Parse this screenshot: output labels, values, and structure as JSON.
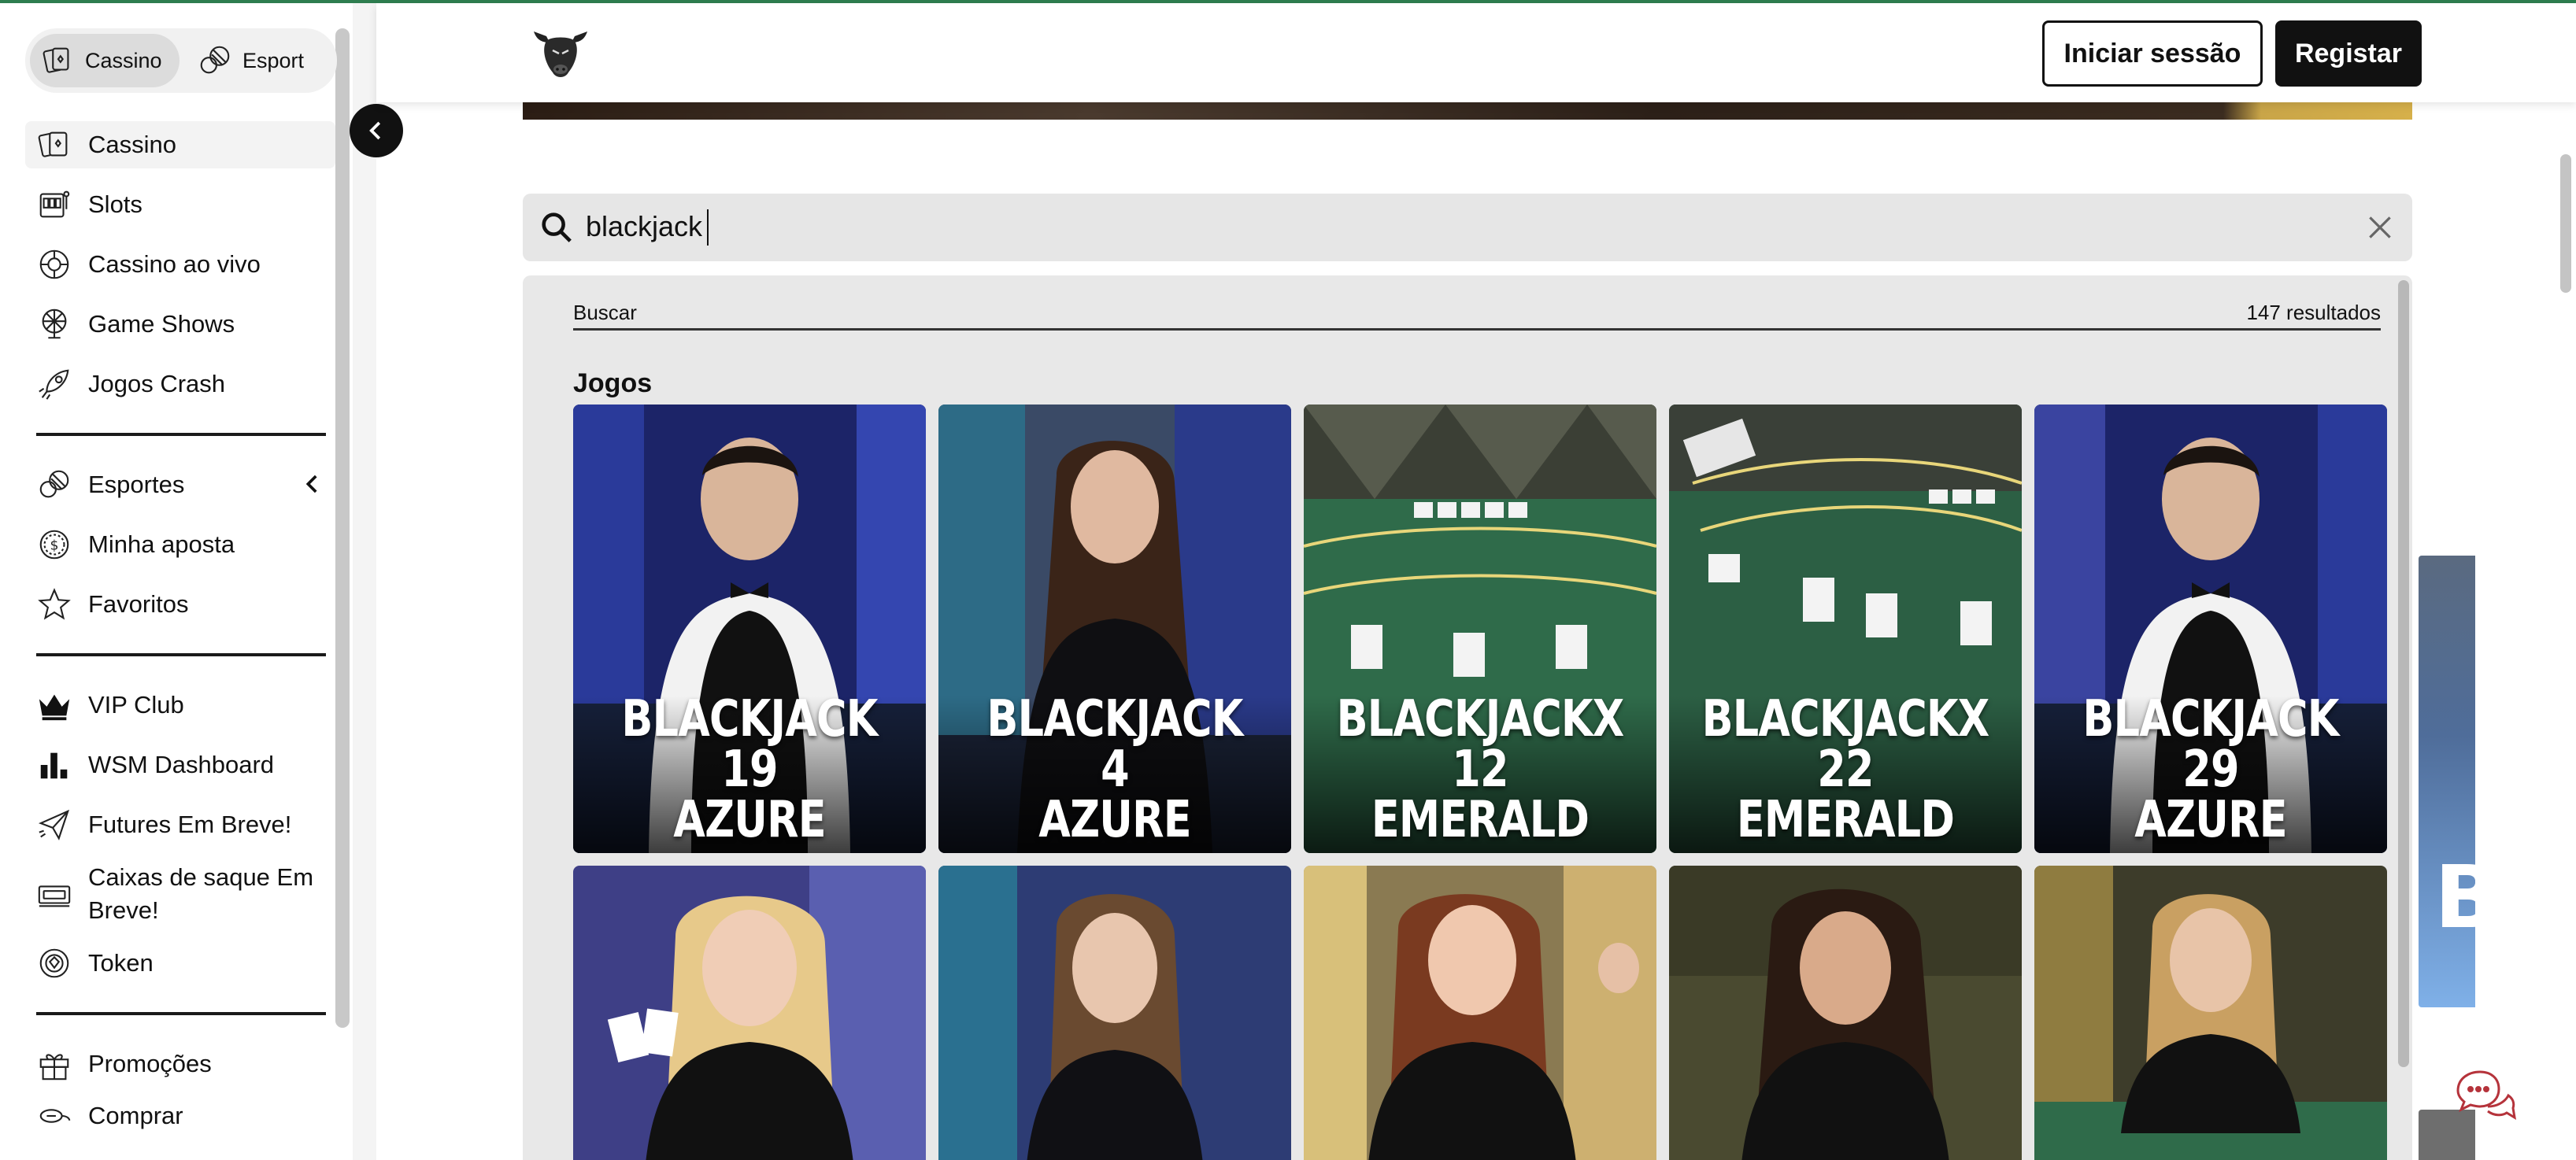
{
  "switcher": {
    "casino_label": "Cassino",
    "esport_label": "Esport"
  },
  "sidebar": {
    "items": [
      {
        "label": "Cassino"
      },
      {
        "label": "Slots"
      },
      {
        "label": "Cassino ao vivo"
      },
      {
        "label": "Game Shows"
      },
      {
        "label": "Jogos Crash"
      },
      {
        "label": "Esportes"
      },
      {
        "label": "Minha aposta"
      },
      {
        "label": "Favoritos"
      },
      {
        "label": "VIP Club"
      },
      {
        "label": "WSM Dashboard"
      },
      {
        "label": "Futures Em Breve!"
      },
      {
        "label": "Caixas de saque Em Breve!"
      },
      {
        "label": "Token"
      },
      {
        "label": "Promoções"
      },
      {
        "label": "Comprar"
      }
    ]
  },
  "header": {
    "login_label": "Iniciar sessão",
    "register_label": "Registar"
  },
  "search": {
    "value": "blackjack",
    "placeholder": ""
  },
  "results": {
    "tab_label": "Buscar",
    "count_label": "147 resultados",
    "section_title": "Jogos",
    "games": [
      {
        "title_line1": "BLACKJACK 19",
        "title_line2": "AZURE"
      },
      {
        "title_line1": "BLACKJACK 4",
        "title_line2": "AZURE"
      },
      {
        "title_line1": "BLACKJACKX 12",
        "title_line2": "EMERALD"
      },
      {
        "title_line1": "BLACKJACKX 22",
        "title_line2": "EMERALD"
      },
      {
        "title_line1": "BLACKJACK 29",
        "title_line2": "AZURE"
      }
    ]
  },
  "side_promo": {
    "letter": "B"
  },
  "colors": {
    "accent_top": "#2e7d4f",
    "primary_dark": "#111111",
    "emerald_felt": "#2f6b4a",
    "azure_bg": "#1f2a6e"
  }
}
